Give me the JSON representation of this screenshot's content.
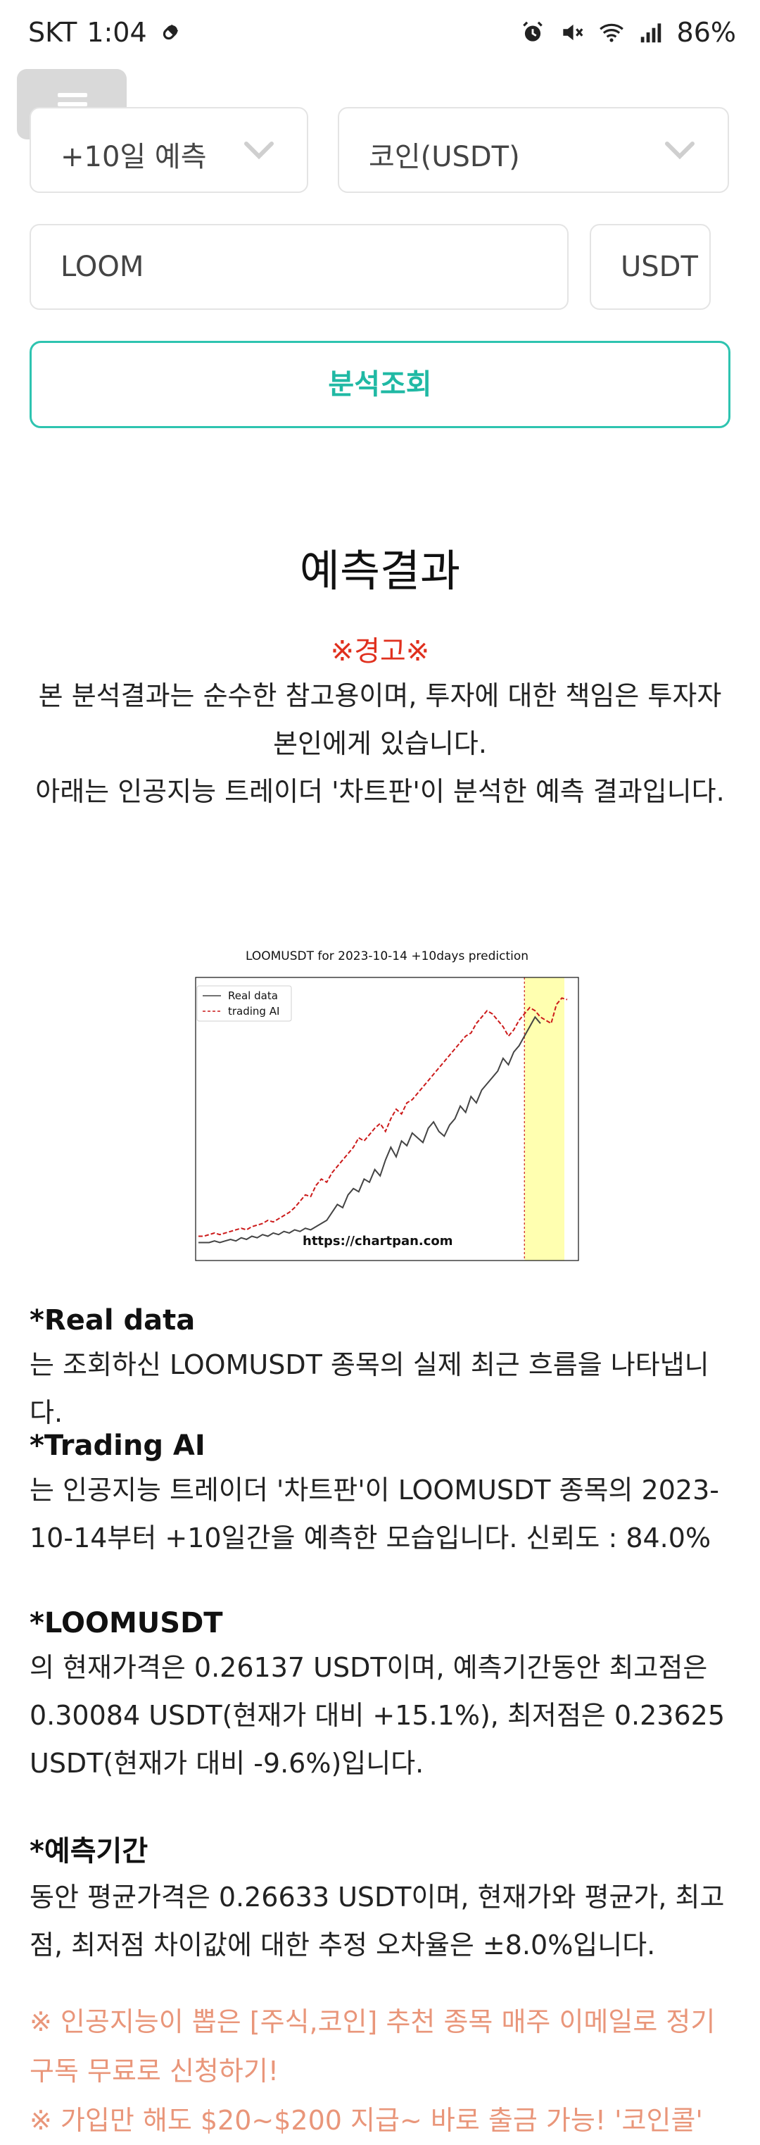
{
  "status_bar": {
    "carrier": "SKT",
    "time": "1:04",
    "battery": "86%"
  },
  "controls": {
    "period_select": "+10일 예측",
    "market_select": "코인(USDT)",
    "symbol_value": "LOOM",
    "currency_value": "USDT",
    "analyze_label": "분석조회"
  },
  "result": {
    "title": "예측결과",
    "warning_title": "※경고※",
    "warning_text": "본 분석결과는 순수한 참고용이며, 투자에 대한 책임은 투자자 본인에게 있습니다.",
    "intro_text": "아래는 인공지능 트레이더 '차트판'이 분석한 예측 결과입니다."
  },
  "chart_data": {
    "type": "line",
    "title": "LOOMUSDT for 2023-10-14 +10days prediction",
    "watermark": "https://chartpan.com",
    "legend_position": "top-left",
    "grid": false,
    "forecast_region_color": "#ffffb0",
    "series": [
      {
        "name": "Real data",
        "color": "#444444",
        "style": "solid",
        "values": [
          0.146,
          0.146,
          0.146,
          0.147,
          0.146,
          0.147,
          0.148,
          0.147,
          0.149,
          0.148,
          0.15,
          0.149,
          0.151,
          0.15,
          0.152,
          0.151,
          0.153,
          0.152,
          0.154,
          0.153,
          0.155,
          0.154,
          0.156,
          0.158,
          0.16,
          0.165,
          0.17,
          0.168,
          0.176,
          0.18,
          0.178,
          0.186,
          0.184,
          0.192,
          0.188,
          0.198,
          0.206,
          0.2,
          0.21,
          0.207,
          0.215,
          0.212,
          0.209,
          0.218,
          0.222,
          0.216,
          0.213,
          0.22,
          0.224,
          0.232,
          0.228,
          0.238,
          0.234,
          0.242,
          0.246,
          0.25,
          0.254,
          0.262,
          0.258,
          0.266,
          0.27,
          0.276,
          0.282,
          0.288,
          0.284
        ]
      },
      {
        "name": "trading AI",
        "color": "#cc1a1a",
        "style": "dashed",
        "values": [
          0.15,
          0.15,
          0.151,
          0.152,
          0.151,
          0.152,
          0.153,
          0.154,
          0.155,
          0.154,
          0.156,
          0.157,
          0.158,
          0.16,
          0.159,
          0.161,
          0.163,
          0.165,
          0.168,
          0.172,
          0.176,
          0.175,
          0.182,
          0.186,
          0.184,
          0.19,
          0.194,
          0.198,
          0.202,
          0.206,
          0.212,
          0.21,
          0.214,
          0.218,
          0.221,
          0.216,
          0.224,
          0.23,
          0.227,
          0.234,
          0.236,
          0.24,
          0.244,
          0.248,
          0.252,
          0.256,
          0.26,
          0.264,
          0.268,
          0.272,
          0.276,
          0.278,
          0.284,
          0.288,
          0.292,
          0.29,
          0.286,
          0.282,
          0.276,
          0.28,
          0.286,
          0.29,
          0.294,
          0.292,
          0.288,
          0.286,
          0.284,
          0.296,
          0.3,
          0.299
        ]
      }
    ],
    "forecast_start_index": 61,
    "ylim": [
      0.14,
      0.305
    ]
  },
  "sections": [
    {
      "head": "*Real data",
      "body": "는 조회하신 LOOMUSDT 종목의 실제 최근 흐름을 나타냅니다."
    },
    {
      "head": "*Trading AI",
      "body": "는 인공지능 트레이더 '차트판'이 LOOMUSDT 종목의 2023-10-14부터 +10일간을 예측한 모습입니다. 신뢰도 : 84.0%"
    },
    {
      "head": "*LOOMUSDT",
      "body": "의 현재가격은 0.26137 USDT이며, 예측기간동안 최고점은 0.30084 USDT(현재가 대비 +15.1%), 최저점은 0.23625 USDT(현재가 대비 -9.6%)입니다."
    },
    {
      "head": "*예측기간",
      "body": "동안 평균가격은 0.26633 USDT이며, 현재가와 평균가, 최고점, 최저점 차이값에 대한 추정 오차율은 ±8.0%입니다."
    }
  ],
  "promo": {
    "line1": "※ 인공지능이 뽑은 [주식,코인] 추천 종목 매주 이메일로 정기구독 무료로 신청하기!",
    "line2": "※ 가입만 해도 $20~$200 지급~ 바로 출금 가능! '코인콜'"
  }
}
